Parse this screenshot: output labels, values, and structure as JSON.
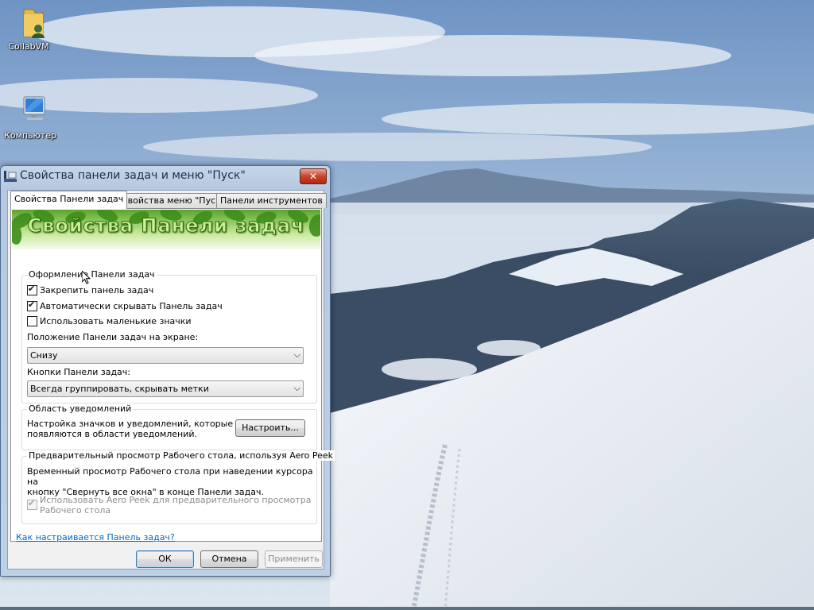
{
  "desktop": {
    "icons": [
      {
        "label": "CollabVM",
        "icon": "user-folder-icon"
      },
      {
        "label": "Компьютер",
        "icon": "computer-icon"
      }
    ]
  },
  "window": {
    "title": "Свойства панели задач и меню \"Пуск\"",
    "close_label": "✕",
    "tabs": [
      {
        "label": "Свойства Панели задач",
        "active": true
      },
      {
        "label": "Свойства меню \"Пуск\"",
        "active": false
      },
      {
        "label": "Панели инструментов",
        "active": false
      }
    ],
    "banner_text": "Свойства Панели задач",
    "appearance": {
      "title": "Оформление Панели задач",
      "lock_label": "Закрепить панель задач",
      "lock_checked": true,
      "autohide_label": "Автоматически скрывать Панель задач",
      "autohide_checked": true,
      "small_icons_label": "Использовать маленькие значки",
      "small_icons_checked": false,
      "position_label": "Положение Панели задач на экране:",
      "position_value": "Снизу",
      "buttons_label": "Кнопки Панели задач:",
      "buttons_value": "Всегда группировать, скрывать метки"
    },
    "notify": {
      "title": "Область уведомлений",
      "description_line1": "Настройка значков и уведомлений, которые",
      "description_line2": "появляются в области уведомлений.",
      "configure_label": "Настроить..."
    },
    "peek": {
      "title": "Предварительный просмотр Рабочего стола, используя Aero Peek",
      "description_line1": "Временный просмотр Рабочего стола при наведении курсора на",
      "description_line2": "кнопку \"Свернуть все окна\" в конце Панели задач.",
      "use_peek_line1": "Использовать Aero Peek для предварительного просмотра",
      "use_peek_line2": "Рабочего стола",
      "use_peek_checked": true,
      "use_peek_enabled": false
    },
    "help_link": "Как настраивается Панель задач?",
    "buttons": {
      "ok": "ОК",
      "cancel": "Отмена",
      "apply": "Применить"
    }
  }
}
